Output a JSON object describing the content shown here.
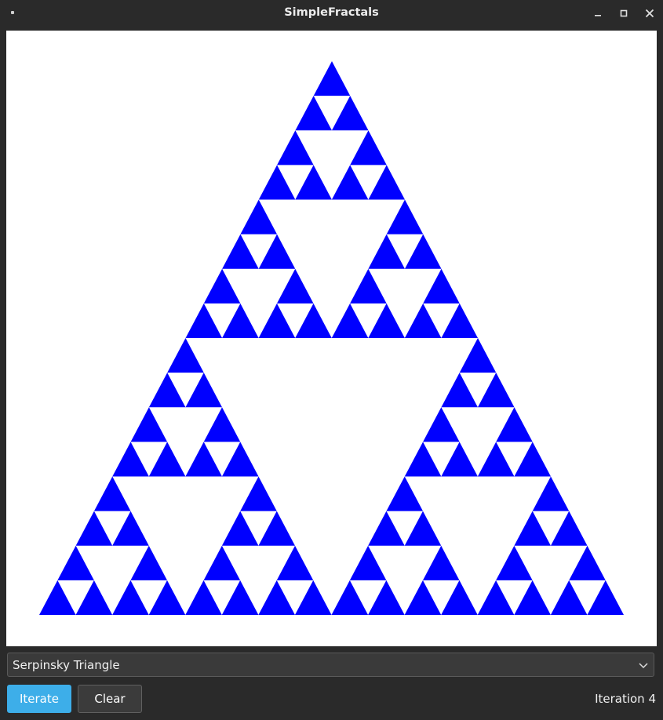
{
  "window": {
    "title": "SimpleFractals",
    "controls": [
      "minimize-icon",
      "maximize-icon",
      "close-icon"
    ]
  },
  "canvas": {
    "fractal": "sierpinski",
    "depth": 4,
    "fill_color": "#0000ff",
    "background_color": "#ffffff"
  },
  "controls": {
    "fractal_select": {
      "selected": "Serpinsky Triangle"
    },
    "iterate_label": "Iterate",
    "clear_label": "Clear",
    "status_text": "Iteration 4"
  },
  "colors": {
    "accent": "#3daee9",
    "window_bg": "#2a2a2a"
  }
}
